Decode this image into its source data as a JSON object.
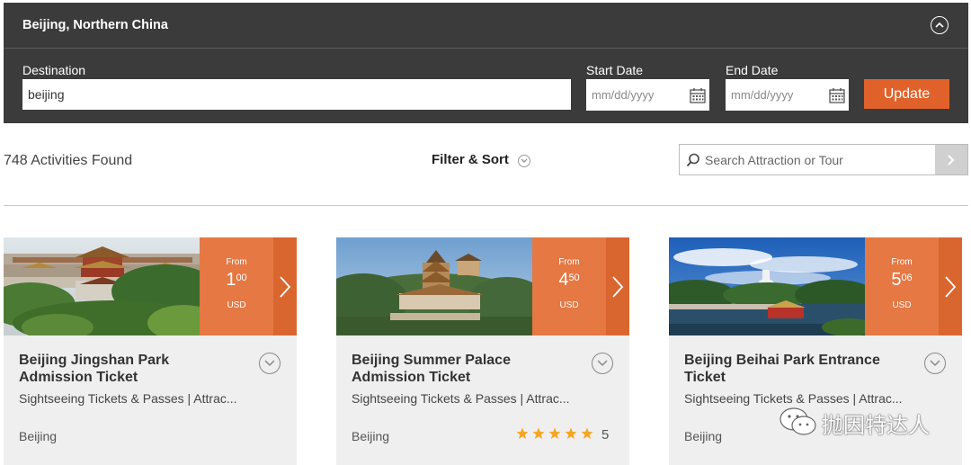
{
  "header": {
    "title": "Beijing, Northern China"
  },
  "search_form": {
    "destination_label": "Destination",
    "destination_value": "beijing",
    "start_date_label": "Start Date",
    "start_date_placeholder": "mm/dd/yyyy",
    "end_date_label": "End Date",
    "end_date_placeholder": "mm/dd/yyyy",
    "update_label": "Update"
  },
  "toolbar": {
    "results_count": "748 Activities Found",
    "filter_sort_label": "Filter & Sort",
    "search_placeholder": "Search Attraction or Tour"
  },
  "cards": [
    {
      "title": "Beijing Jingshan Park Admission Ticket",
      "category": "Sightseeing Tickets & Passes | Attrac...",
      "location": "Beijing",
      "price_from": "From",
      "price_main": "1",
      "price_cents": "00",
      "currency": "USD"
    },
    {
      "title": "Beijing Summer Palace Admission Ticket",
      "category": "Sightseeing Tickets & Passes | Attrac...",
      "location": "Beijing",
      "price_from": "From",
      "price_main": "4",
      "price_cents": "50",
      "currency": "USD",
      "rating": "5"
    },
    {
      "title": "Beijing Beihai Park Entrance Ticket",
      "category": "Sightseeing Tickets & Passes | Attrac...",
      "location": "Beijing",
      "price_from": "From",
      "price_main": "5",
      "price_cents": "06",
      "currency": "USD"
    }
  ],
  "watermark": "抛因特达人",
  "colors": {
    "panel_bg": "#3b3b3b",
    "accent": "#e0622a",
    "price_bg": "#e57843",
    "star": "#f5a623"
  }
}
